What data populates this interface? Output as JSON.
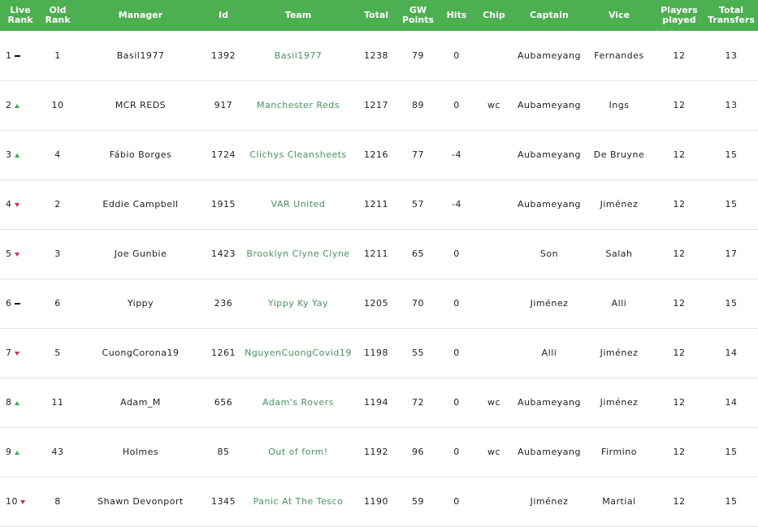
{
  "headers": {
    "live_rank": [
      "Live",
      "Rank"
    ],
    "old_rank": [
      "Old",
      "Rank"
    ],
    "manager": "Manager",
    "id": "Id",
    "team": "Team",
    "total": "Total",
    "gw_points": [
      "GW",
      "Points"
    ],
    "hits": "Hits",
    "chip": "Chip",
    "captain": "Captain",
    "vice": "Vice",
    "players_played": [
      "Players",
      "played"
    ],
    "total_transfers": [
      "Total",
      "Transfers"
    ]
  },
  "rows": [
    {
      "live_rank": "1",
      "movement": "same",
      "old_rank": "1",
      "manager": "Basil1977",
      "id": "1392",
      "team": "Basil1977",
      "total": "1238",
      "gw_points": "79",
      "hits": "0",
      "chip": "",
      "captain": "Aubameyang",
      "vice": "Fernandes",
      "players_played": "12",
      "total_transfers": "13"
    },
    {
      "live_rank": "2",
      "movement": "up",
      "old_rank": "10",
      "manager": "MCR REDS",
      "id": "917",
      "team": "Manchester Reds",
      "total": "1217",
      "gw_points": "89",
      "hits": "0",
      "chip": "wc",
      "captain": "Aubameyang",
      "vice": "Ings",
      "players_played": "12",
      "total_transfers": "13"
    },
    {
      "live_rank": "3",
      "movement": "up",
      "old_rank": "4",
      "manager": "Fábio Borges",
      "id": "1724",
      "team": "Clichys Cleansheets",
      "total": "1216",
      "gw_points": "77",
      "hits": "-4",
      "chip": "",
      "captain": "Aubameyang",
      "vice": "De Bruyne",
      "players_played": "12",
      "total_transfers": "15"
    },
    {
      "live_rank": "4",
      "movement": "down",
      "old_rank": "2",
      "manager": "Eddie Campbell",
      "id": "1915",
      "team": "VAR United",
      "total": "1211",
      "gw_points": "57",
      "hits": "-4",
      "chip": "",
      "captain": "Aubameyang",
      "vice": "Jiménez",
      "players_played": "12",
      "total_transfers": "15"
    },
    {
      "live_rank": "5",
      "movement": "down",
      "old_rank": "3",
      "manager": "Joe Gunbie",
      "id": "1423",
      "team": "Brooklyn Clyne Clyne",
      "total": "1211",
      "gw_points": "65",
      "hits": "0",
      "chip": "",
      "captain": "Son",
      "vice": "Salah",
      "players_played": "12",
      "total_transfers": "17"
    },
    {
      "live_rank": "6",
      "movement": "same",
      "old_rank": "6",
      "manager": "Yippy",
      "id": "236",
      "team": "Yippy Ky Yay",
      "total": "1205",
      "gw_points": "70",
      "hits": "0",
      "chip": "",
      "captain": "Jiménez",
      "vice": "Alli",
      "players_played": "12",
      "total_transfers": "15"
    },
    {
      "live_rank": "7",
      "movement": "down",
      "old_rank": "5",
      "manager": "CuongCorona19",
      "id": "1261",
      "team": "NguyenCuongCovid19",
      "total": "1198",
      "gw_points": "55",
      "hits": "0",
      "chip": "",
      "captain": "Alli",
      "vice": "Jiménez",
      "players_played": "12",
      "total_transfers": "14"
    },
    {
      "live_rank": "8",
      "movement": "up",
      "old_rank": "11",
      "manager": "Adam_M",
      "id": "656",
      "team": "Adam's Rovers",
      "total": "1194",
      "gw_points": "72",
      "hits": "0",
      "chip": "wc",
      "captain": "Aubameyang",
      "vice": "Jiménez",
      "players_played": "12",
      "total_transfers": "14"
    },
    {
      "live_rank": "9",
      "movement": "up",
      "old_rank": "43",
      "manager": "Holmes",
      "id": "85",
      "team": "Out of form!",
      "total": "1192",
      "gw_points": "96",
      "hits": "0",
      "chip": "wc",
      "captain": "Aubameyang",
      "vice": "Firmino",
      "players_played": "12",
      "total_transfers": "15"
    },
    {
      "live_rank": "10",
      "movement": "down",
      "old_rank": "8",
      "manager": "Shawn Devonport",
      "id": "1345",
      "team": "Panic At The Tesco",
      "total": "1190",
      "gw_points": "59",
      "hits": "0",
      "chip": "",
      "captain": "Jiménez",
      "vice": "Martial",
      "players_played": "12",
      "total_transfers": "15"
    }
  ],
  "colors": {
    "header_bg": "#4caf50",
    "team_link": "#3e9b5c",
    "up_arrow": "#2fb04a",
    "down_arrow": "#e0245e"
  }
}
